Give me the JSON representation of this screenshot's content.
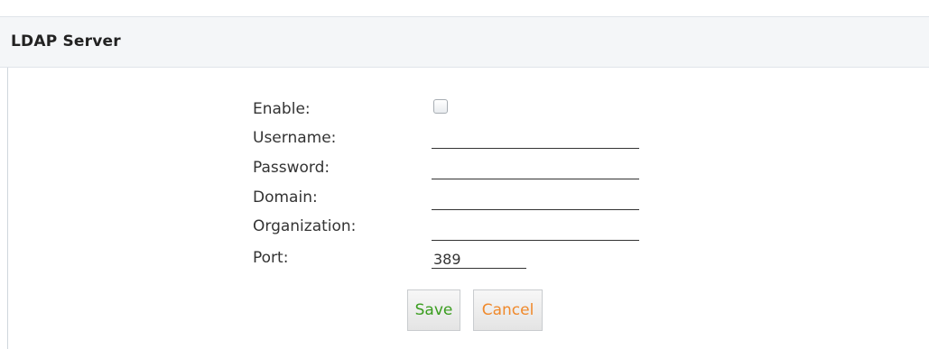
{
  "panel": {
    "title": "LDAP Server"
  },
  "form": {
    "enable_label": "Enable:",
    "enable_checked": false,
    "username_label": "Username:",
    "username_value": "",
    "password_label": "Password:",
    "password_value": "",
    "domain_label": "Domain:",
    "domain_value": "",
    "organization_label": "Organization:",
    "organization_value": "",
    "port_label": "Port:",
    "port_value": "389"
  },
  "actions": {
    "save_label": "Save",
    "cancel_label": "Cancel"
  },
  "colors": {
    "save_text": "#3a9d1f",
    "cancel_text": "#f0892b",
    "header_bg": "#f4f6f8"
  }
}
